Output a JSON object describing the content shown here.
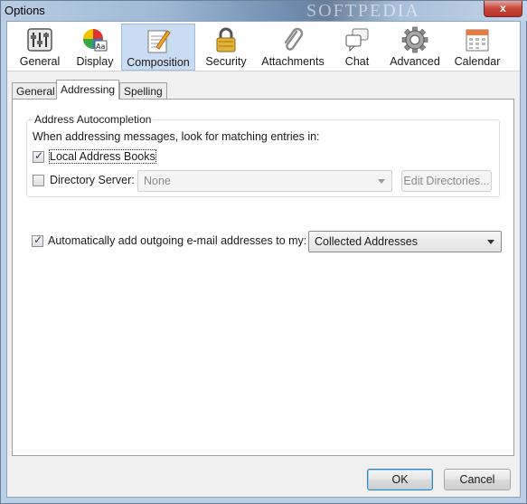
{
  "window": {
    "title": "Options",
    "watermark": "SOFTPEDIA",
    "close_symbol": "x"
  },
  "toolbar": {
    "items": [
      {
        "label": "General",
        "icon": "sliders-icon"
      },
      {
        "label": "Display",
        "icon": "color-wheel-icon"
      },
      {
        "label": "Composition",
        "icon": "pencil-note-icon",
        "selected": true
      },
      {
        "label": "Security",
        "icon": "padlock-icon"
      },
      {
        "label": "Attachments",
        "icon": "paperclip-icon"
      },
      {
        "label": "Chat",
        "icon": "speech-bubbles-icon"
      },
      {
        "label": "Advanced",
        "icon": "gear-icon"
      },
      {
        "label": "Calendar",
        "icon": "calendar-icon"
      }
    ]
  },
  "tabs": [
    {
      "label": "General"
    },
    {
      "label": "Addressing",
      "active": true
    },
    {
      "label": "Spelling"
    }
  ],
  "autocompletion": {
    "group_label": "Address Autocompletion",
    "description": "When addressing messages, look for matching entries in:",
    "local_books_label": "Local Address Books",
    "local_books_checked": true,
    "directory_server_label": "Directory Server:",
    "directory_server_checked": false,
    "directory_server_value": "None",
    "edit_directories_label": "Edit Directories..."
  },
  "auto_add": {
    "label": "Automatically add outgoing e-mail addresses to my:",
    "checked": true,
    "selected_value": "Collected Addresses"
  },
  "footer": {
    "ok_label": "OK",
    "cancel_label": "Cancel"
  },
  "colors": {
    "selected_toolbar_bg": "#c9dcf1",
    "default_button_border": "#3c7fb1"
  }
}
